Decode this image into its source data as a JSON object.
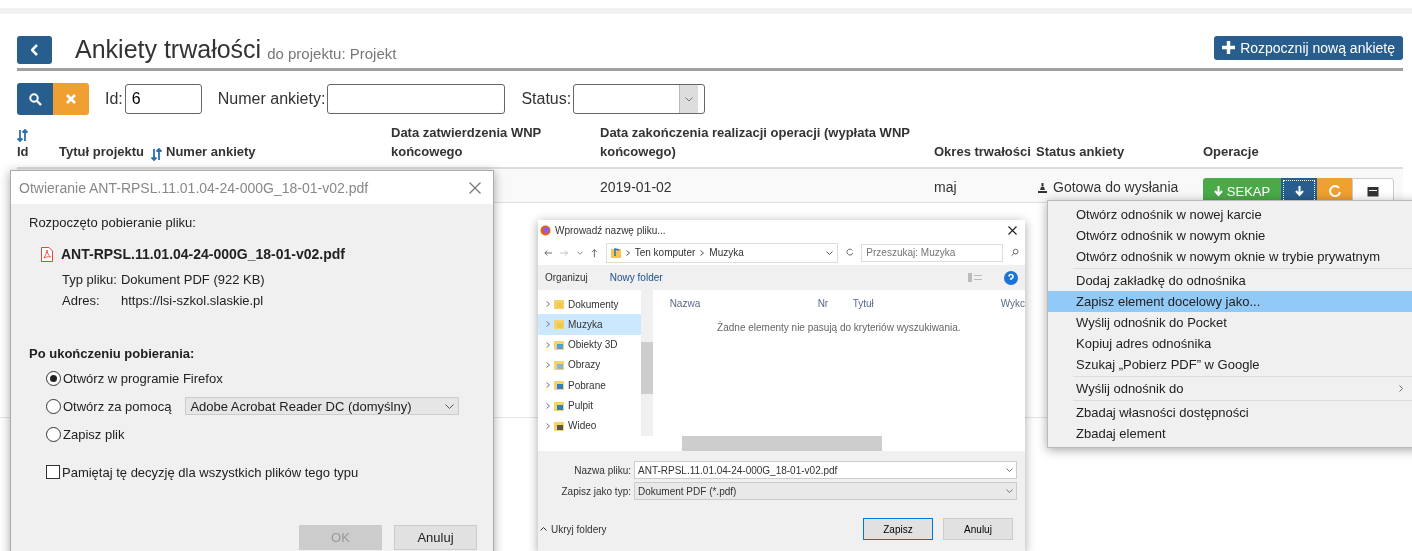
{
  "page": {
    "title": "Ankiety trwałości",
    "subtitle": "do projektu: Projekt",
    "new_button": "Rozpocznij nową ankietę"
  },
  "filters": [
    {
      "label": "Id:",
      "value": "6",
      "kind": "text"
    },
    {
      "label": "Numer ankiety:",
      "kind": "text"
    },
    {
      "label": "Status:",
      "kind": "select"
    }
  ],
  "table": {
    "columns": [
      {
        "label": "Id",
        "sortable": true
      },
      {
        "label": "Tytuł projektu",
        "sortable": false
      },
      {
        "label": "Numer ankiety",
        "sortable": true
      },
      {
        "label": "Data zatwierdzenia WNP końcowego",
        "sortable": false
      },
      {
        "label": "Data zakończenia realizacji operacji (wypłata WNP końcowego)",
        "sortable": false
      },
      {
        "label": "Okres trwałości",
        "sortable": false
      },
      {
        "label": "Status ankiety",
        "sortable": false
      },
      {
        "label": "Operacje",
        "sortable": false
      }
    ],
    "rows": [
      {
        "end_date": "2019-01-02",
        "period": "maj",
        "status": "Gotowa do wysłania",
        "operations": [
          {
            "kind": "sekap",
            "label": "SEKAP"
          },
          {
            "kind": "download"
          },
          {
            "kind": "refresh"
          },
          {
            "kind": "calendar"
          }
        ]
      }
    ]
  },
  "open_dialog": {
    "title": "Otwieranie ANT-RPSL.11.01.04-24-000G_18-01-v02.pdf",
    "intro": "Rozpoczęto pobieranie pliku:",
    "file_name": "ANT-RPSL.11.01.04-24-000G_18-01-v02.pdf",
    "details": [
      {
        "label": "Typ pliku:",
        "value": "Dokument PDF (922 KB)"
      },
      {
        "label": "Adres:",
        "value": "https://lsi-szkol.slaskie.pl"
      }
    ],
    "section": "Po ukończeniu pobierania:",
    "options": [
      {
        "label": "Otwórz w programie Firefox",
        "selected": true
      },
      {
        "label": "Otwórz za pomocą",
        "selected": false,
        "dropdown": "Adobe Acrobat Reader DC (domyślny)"
      },
      {
        "label": "Zapisz plik",
        "selected": false
      }
    ],
    "remember": {
      "label": "Pamiętaj tę decyzję dla wszystkich plików tego typu",
      "checked": false
    },
    "buttons": [
      {
        "label": "OK",
        "disabled": true
      },
      {
        "label": "Anuluj",
        "disabled": false
      }
    ]
  },
  "save_dialog": {
    "title": "Wprowadź nazwę pliku...",
    "breadcrumb": [
      "Ten komputer",
      "Muzyka"
    ],
    "search": {
      "placeholder": "Przeszukaj: Muzyka"
    },
    "toolbar": [
      "Organizuj",
      "Nowy folder"
    ],
    "tree": [
      {
        "label": "Dokumenty",
        "selected": false
      },
      {
        "label": "Muzyka",
        "selected": true
      },
      {
        "label": "Obiekty 3D",
        "selected": false
      },
      {
        "label": "Obrazy",
        "selected": false
      },
      {
        "label": "Pobrane",
        "selected": false
      },
      {
        "label": "Pulpit",
        "selected": false
      },
      {
        "label": "Wideo",
        "selected": false
      }
    ],
    "columns": [
      "Nazwa",
      "Nr",
      "Tytuł",
      "Wykc"
    ],
    "empty_message": "Żadne elementy nie pasują do kryteriów wyszukiwania.",
    "file_name": {
      "label": "Nazwa pliku:",
      "value": "ANT-RPSL.11.01.04-24-000G_18-01-v02.pdf"
    },
    "file_type": {
      "label": "Zapisz jako typ:",
      "value": "Dokument PDF (*.pdf)"
    },
    "hide_folders": "Ukryj foldery",
    "buttons": [
      {
        "label": "Zapisz",
        "default": true
      },
      {
        "label": "Anuluj",
        "default": false
      }
    ]
  },
  "context_menu": {
    "groups": [
      [
        {
          "label": "Otwórz odnośnik w nowej karcie",
          "selected": false
        },
        {
          "label": "Otwórz odnośnik w nowym oknie",
          "selected": false
        },
        {
          "label": "Otwórz odnośnik w nowym oknie w trybie prywatnym",
          "selected": false
        }
      ],
      [
        {
          "label": "Dodaj zakładkę do odnośnika",
          "selected": false
        },
        {
          "label": "Zapisz element docelowy jako...",
          "selected": true
        },
        {
          "label": "Wyślij odnośnik do Pocket",
          "selected": false
        },
        {
          "label": "Kopiuj adres odnośnika",
          "selected": false
        },
        {
          "label": "Szukaj „Pobierz PDF” w Google",
          "selected": false
        }
      ],
      [
        {
          "label": "Wyślij odnośnik do",
          "selected": false,
          "submenu": true
        }
      ],
      [
        {
          "label": "Zbadaj własności dostępności",
          "selected": false
        },
        {
          "label": "Zbadaj element",
          "selected": false
        }
      ]
    ]
  }
}
